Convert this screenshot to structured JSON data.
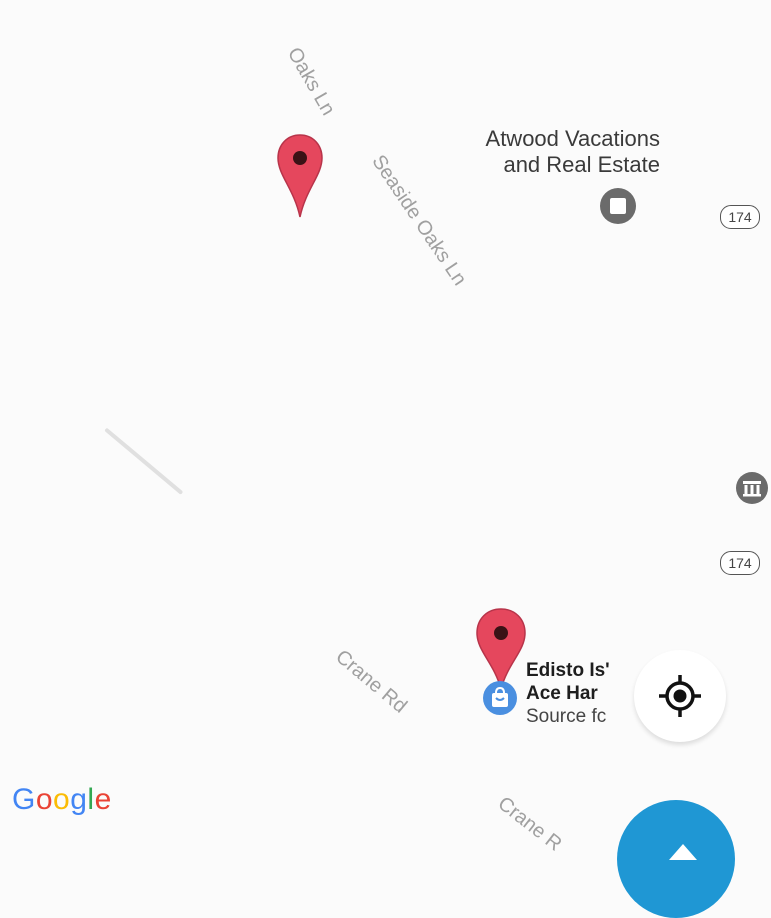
{
  "roads": [
    {
      "name": "Oaks Ln",
      "style": "normal"
    },
    {
      "name": "Seaside Oaks Ln",
      "style": "normal"
    },
    {
      "name": "Crane Rd",
      "style": "normal"
    },
    {
      "name": "Crane R",
      "style": "normal"
    }
  ],
  "route_shields": [
    "174",
    "174"
  ],
  "places": {
    "atwood": {
      "line1": "Atwood Vacations",
      "line2": "and Real Estate",
      "icon": "store-icon"
    },
    "hardware": {
      "line1": "Edisto Is'",
      "line2": "Ace Har",
      "line3": "Source fc",
      "icon": "shopping-bag-icon"
    }
  },
  "icons": {
    "museum": "museum-icon",
    "locate": "my-location-icon",
    "pin": "map-pin-icon",
    "fab": "directions-fab"
  },
  "branding": {
    "logo_letters": [
      "G",
      "o",
      "o",
      "g",
      "l",
      "e"
    ],
    "logo_colors": [
      "#4285f4",
      "#ea4335",
      "#fbbc05",
      "#4285f4",
      "#34a853",
      "#ea4335"
    ]
  },
  "colors": {
    "pin": "#e5475d",
    "pin_dot": "#3a1216",
    "poi_gray": "#6b6b6b",
    "poi_blue": "#4a8fe0",
    "fab": "#1f97d4",
    "road_text": "#a0a0a0"
  }
}
